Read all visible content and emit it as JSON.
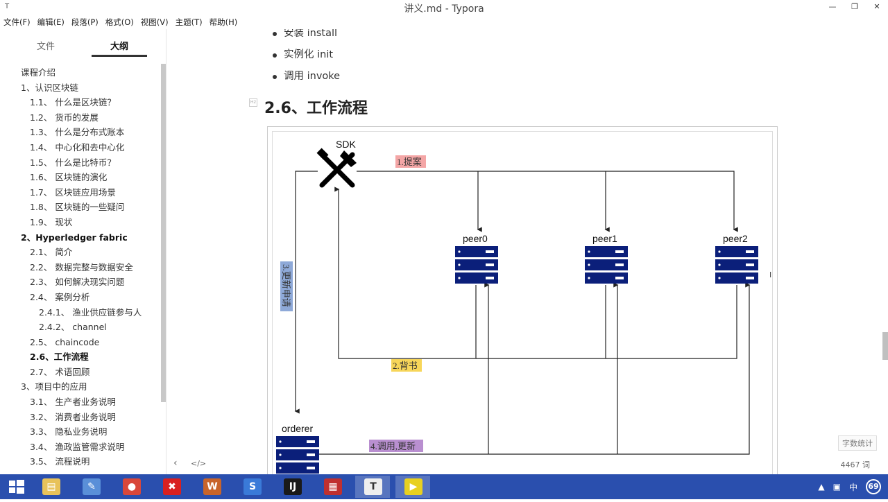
{
  "window": {
    "title": "讲义.md - Typora"
  },
  "menu": [
    "文件(F)",
    "编辑(E)",
    "段落(P)",
    "格式(O)",
    "视图(V)",
    "主题(T)",
    "帮助(H)"
  ],
  "sidebar": {
    "tab_files": "文件",
    "tab_outline": "大纲",
    "items": [
      {
        "label": "课程介绍",
        "level": 1
      },
      {
        "label": "1、认识区块链",
        "level": 1
      },
      {
        "label": "1.1、 什么是区块链？",
        "level": 2
      },
      {
        "label": "1.2、 货币的发展",
        "level": 2
      },
      {
        "label": "1.3、 什么是分布式账本",
        "level": 2
      },
      {
        "label": "1.4、 中心化和去中心化",
        "level": 2
      },
      {
        "label": "1.5、 什么是比特币？",
        "level": 2
      },
      {
        "label": "1.6、 区块链的演化",
        "level": 2
      },
      {
        "label": "1.7、 区块链应用场景",
        "level": 2
      },
      {
        "label": "1.8、 区块链的一些疑问",
        "level": 2
      },
      {
        "label": "1.9、 现状",
        "level": 2
      },
      {
        "label": "2、Hyperledger fabric",
        "level": 1,
        "bold": true
      },
      {
        "label": "2.1、 简介",
        "level": 2
      },
      {
        "label": "2.2、 数据完整与数据安全",
        "level": 2
      },
      {
        "label": "2.3、 如何解决现实问题",
        "level": 2
      },
      {
        "label": "2.4、 案例分析",
        "level": 2
      },
      {
        "label": "2.4.1、 渔业供应链参与人",
        "level": 3
      },
      {
        "label": "2.4.2、 channel",
        "level": 3
      },
      {
        "label": "2.5、 chaincode",
        "level": 2
      },
      {
        "label": "2.6、工作流程",
        "level": 2,
        "bold": true
      },
      {
        "label": "2.7、 术语回顾",
        "level": 2
      },
      {
        "label": "3、项目中的应用",
        "level": 1
      },
      {
        "label": "3.1、 生产者业务说明",
        "level": 2
      },
      {
        "label": "3.2、 消费者业务说明",
        "level": 2
      },
      {
        "label": "3.3、 隐私业务说明",
        "level": 2
      },
      {
        "label": "3.4、 渔政监管需求说明",
        "level": 2
      },
      {
        "label": "3.5、 流程说明",
        "level": 2
      }
    ],
    "footer_back": "‹",
    "footer_code": "</>"
  },
  "content": {
    "bullets": [
      "安装 install",
      "实例化 init",
      "调用 invoke"
    ],
    "heading": "2.6、工作流程",
    "heading_marker": "H2",
    "word_stat_button": "字数统计",
    "word_count": "4467 词"
  },
  "diagram": {
    "sdk_label": "SDK",
    "peers": [
      "peer0",
      "peer1",
      "peer2"
    ],
    "orderer_label": "orderer",
    "step1": "1.提案",
    "step2": "2.背书",
    "step3": "3.更新申请",
    "step4": "4.调用,更新",
    "colors": {
      "server": "#0b1f7a",
      "step1": "#f4a6a6",
      "step2": "#f7d65a",
      "step3": "#8ea9d8",
      "step4": "#b98fd0"
    }
  },
  "taskbar": {
    "apps": [
      {
        "name": "file-explorer",
        "glyph": "▤",
        "color": "#e8c25a"
      },
      {
        "name": "paint",
        "glyph": "✎",
        "color": "#5a8fd8"
      },
      {
        "name": "chrome",
        "glyph": "●",
        "color": "#d9473a"
      },
      {
        "name": "xmind",
        "glyph": "✖",
        "color": "#d92020"
      },
      {
        "name": "office",
        "glyph": "W",
        "color": "#c8642a"
      },
      {
        "name": "editor",
        "glyph": "S",
        "color": "#3a7ad8"
      },
      {
        "name": "intellij",
        "glyph": "IJ",
        "color": "#1a1a1a"
      },
      {
        "name": "notes",
        "glyph": "▦",
        "color": "#c03030"
      },
      {
        "name": "typora",
        "glyph": "T",
        "color": "#eeeeee"
      },
      {
        "name": "recorder",
        "glyph": "▶",
        "color": "#e8d020"
      }
    ],
    "tray_ime": "中",
    "tray_badge": "69"
  }
}
